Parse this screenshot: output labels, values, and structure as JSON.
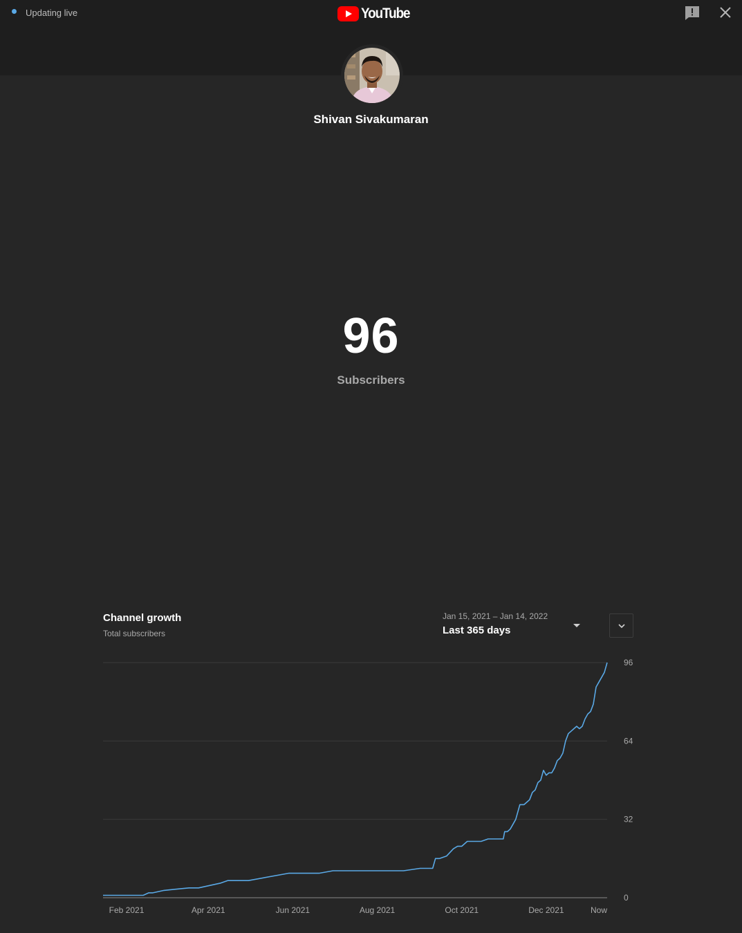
{
  "status": {
    "live_label": "Updating live",
    "dot_color": "#5aa9e6"
  },
  "header": {
    "logo_text": "YouTube",
    "logo_color": "#ff0000",
    "feedback_icon": "feedback-icon",
    "close_icon": "close-icon"
  },
  "channel": {
    "name": "Shivan Sivakumaran",
    "subscriber_count": "96",
    "subscriber_label": "Subscribers"
  },
  "growth": {
    "title": "Channel growth",
    "subtitle": "Total subscribers",
    "date_range": "Jan 15, 2021 – Jan 14, 2022",
    "range_label": "Last 365 days",
    "expand_icon": "chevron-down-icon"
  },
  "chart_data": {
    "type": "line",
    "title": "",
    "xlabel": "",
    "ylabel": "",
    "ylim": [
      0,
      96
    ],
    "y_ticks": [
      0,
      32,
      64,
      96
    ],
    "y_tick_labels": [
      "0",
      "32",
      "64",
      "96"
    ],
    "x_ticks": [
      {
        "label": "Feb 2021",
        "x": "2021-02-01"
      },
      {
        "label": "Apr 2021",
        "x": "2021-04-01"
      },
      {
        "label": "Jun 2021",
        "x": "2021-06-01"
      },
      {
        "label": "Aug 2021",
        "x": "2021-08-01"
      },
      {
        "label": "Oct 2021",
        "x": "2021-10-01"
      },
      {
        "label": "Dec 2021",
        "x": "2021-12-01"
      },
      {
        "label": "Now",
        "x": "2022-01-14"
      }
    ],
    "xlim": [
      "2021-01-15",
      "2022-01-14"
    ],
    "grid": true,
    "line_color": "#5aa9e6",
    "series": [
      {
        "x": [
          "2021-01-15",
          "2021-02-13",
          "2021-02-17",
          "2021-02-20",
          "2021-02-28",
          "2021-03-18",
          "2021-03-25",
          "2021-04-10",
          "2021-04-15",
          "2021-04-30",
          "2021-05-29",
          "2021-06-20",
          "2021-06-30",
          "2021-07-20",
          "2021-08-01",
          "2021-08-20",
          "2021-09-01",
          "2021-09-02",
          "2021-09-05",
          "2021-09-10",
          "2021-09-12",
          "2021-09-15",
          "2021-09-20",
          "2021-09-25",
          "2021-09-28",
          "2021-10-01",
          "2021-10-05",
          "2021-10-10",
          "2021-10-15",
          "2021-10-20",
          "2021-10-25",
          "2021-10-31",
          "2021-11-01",
          "2021-11-03",
          "2021-11-05",
          "2021-11-07",
          "2021-11-09",
          "2021-11-12",
          "2021-11-15",
          "2021-11-17",
          "2021-11-19",
          "2021-11-21",
          "2021-11-23",
          "2021-11-25",
          "2021-11-27",
          "2021-11-29",
          "2021-12-01",
          "2021-12-03",
          "2021-12-05",
          "2021-12-07",
          "2021-12-09",
          "2021-12-11",
          "2021-12-13",
          "2021-12-15",
          "2021-12-17",
          "2021-12-19",
          "2021-12-21",
          "2021-12-23",
          "2021-12-25",
          "2021-12-27",
          "2021-12-29",
          "2021-12-31",
          "2022-01-02",
          "2022-01-04",
          "2022-01-06",
          "2022-01-08",
          "2022-01-10",
          "2022-01-12",
          "2022-01-14"
        ],
        "y": [
          1,
          1,
          2,
          2,
          3,
          4,
          4,
          6,
          7,
          7,
          10,
          10,
          11,
          11,
          11,
          11,
          12,
          12,
          12,
          12,
          16,
          16,
          17,
          20,
          21,
          21,
          23,
          23,
          23,
          24,
          24,
          24,
          27,
          27,
          28,
          30,
          32,
          38,
          38,
          39,
          40,
          43,
          44,
          47,
          48,
          52,
          50,
          51,
          51,
          53,
          56,
          57,
          59,
          64,
          67,
          68,
          69,
          70,
          69,
          70,
          73,
          75,
          76,
          79,
          86,
          88,
          90,
          92,
          96
        ]
      }
    ]
  }
}
